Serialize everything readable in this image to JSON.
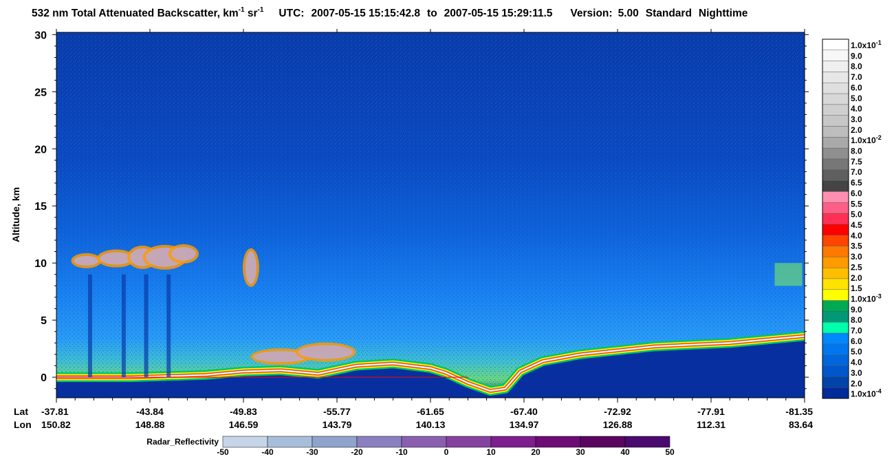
{
  "title": {
    "main": "532 nm Total Attenuated Backscatter, km",
    "unit_exp_1": "-1",
    "sr": " sr",
    "unit_exp_2": "-1",
    "utc_label": "UTC:",
    "utc_start": "2007-05-15 15:15:42.8",
    "to": "to",
    "utc_end": "2007-05-15 15:29:11.5",
    "version_label": "Version:",
    "version": "5.00",
    "product": "Standard",
    "mode": "Nighttime"
  },
  "chart_data": {
    "type": "heatmap",
    "ylabel": "Altitude, km",
    "ylim": [
      -1.8,
      30.2
    ],
    "y_ticks": [
      "30",
      "25",
      "20",
      "15",
      "10",
      "5",
      "0"
    ],
    "y_tick_values": [
      30,
      25,
      20,
      15,
      10,
      5,
      0
    ],
    "x_row_labels": [
      "Lat",
      "Lon"
    ],
    "x_ticks": [
      {
        "lat": "-37.81",
        "lon": "150.82"
      },
      {
        "lat": "-43.84",
        "lon": "148.88"
      },
      {
        "lat": "-49.83",
        "lon": "146.59"
      },
      {
        "lat": "-55.77",
        "lon": "143.79"
      },
      {
        "lat": "-61.65",
        "lon": "140.13"
      },
      {
        "lat": "-67.40",
        "lon": "134.97"
      },
      {
        "lat": "-72.92",
        "lon": "126.88"
      },
      {
        "lat": "-77.91",
        "lon": "112.31"
      },
      {
        "lat": "-81.35",
        "lon": "83.64"
      }
    ],
    "x_range_lat": [
      -37.81,
      -81.35
    ],
    "surface_altitude_km": [
      [
        0.0,
        0.0
      ],
      [
        0.1,
        0.0
      ],
      [
        0.2,
        0.2
      ],
      [
        0.25,
        0.5
      ],
      [
        0.3,
        0.6
      ],
      [
        0.35,
        0.3
      ],
      [
        0.4,
        1.0
      ],
      [
        0.45,
        1.2
      ],
      [
        0.5,
        0.8
      ],
      [
        0.52,
        0.4
      ],
      [
        0.55,
        -0.5
      ],
      [
        0.58,
        -1.2
      ],
      [
        0.6,
        -1.0
      ],
      [
        0.62,
        0.5
      ],
      [
        0.65,
        1.4
      ],
      [
        0.7,
        2.0
      ],
      [
        0.8,
        2.7
      ],
      [
        0.9,
        3.0
      ],
      [
        1.0,
        3.6
      ]
    ],
    "colorbar": {
      "labels": [
        {
          "label": "1.0x10",
          "exp": "-1"
        },
        {
          "label": "9.0"
        },
        {
          "label": "8.0"
        },
        {
          "label": "7.0"
        },
        {
          "label": "6.0"
        },
        {
          "label": "5.0"
        },
        {
          "label": "4.0"
        },
        {
          "label": "3.0"
        },
        {
          "label": "2.0"
        },
        {
          "label": "1.0x10",
          "exp": "-2"
        },
        {
          "label": "8.0"
        },
        {
          "label": "7.5"
        },
        {
          "label": "7.0"
        },
        {
          "label": "6.5"
        },
        {
          "label": "6.0"
        },
        {
          "label": "5.5"
        },
        {
          "label": "5.0"
        },
        {
          "label": "4.5"
        },
        {
          "label": "4.0"
        },
        {
          "label": "3.5"
        },
        {
          "label": "3.0"
        },
        {
          "label": "2.5"
        },
        {
          "label": "2.0"
        },
        {
          "label": "1.5"
        },
        {
          "label": "1.0x10",
          "exp": "-3"
        },
        {
          "label": "9.0"
        },
        {
          "label": "8.0"
        },
        {
          "label": "7.0"
        },
        {
          "label": "6.0"
        },
        {
          "label": "5.0"
        },
        {
          "label": "4.0"
        },
        {
          "label": "3.0"
        },
        {
          "label": "2.0"
        },
        {
          "label": "1.0x10",
          "exp": "-4"
        }
      ],
      "colors": [
        "#ffffff",
        "#f7f7f7",
        "#efefef",
        "#e7e7e7",
        "#dfdfdf",
        "#d7d7d7",
        "#cfcfcf",
        "#c7c7c7",
        "#bdbdbd",
        "#a9a9a9",
        "#8f8f8f",
        "#777777",
        "#5f5f5f",
        "#444444",
        "#ff8fb0",
        "#ff5f86",
        "#ff2f55",
        "#ff0000",
        "#ff4500",
        "#ff7800",
        "#ff9a00",
        "#ffbf00",
        "#ffe300",
        "#ffff00",
        "#00aa55",
        "#009977",
        "#00ffaa",
        "#0088ff",
        "#0077ee",
        "#0066dd",
        "#0057cc",
        "#0044aa",
        "#002b99"
      ]
    },
    "radar_colorbar": {
      "label": "Radar_Reflectivity",
      "ticks": [
        "-50",
        "-40",
        "-30",
        "-20",
        "-10",
        "0",
        "10",
        "20",
        "30",
        "40",
        "50"
      ],
      "colors": [
        "#c6d6e8",
        "#a7bedb",
        "#8fa3cc",
        "#8a80bf",
        "#8a5fb0",
        "#86429f",
        "#7d1f8e",
        "#6e0c75",
        "#5a0660",
        "#4b0a6e"
      ]
    }
  }
}
